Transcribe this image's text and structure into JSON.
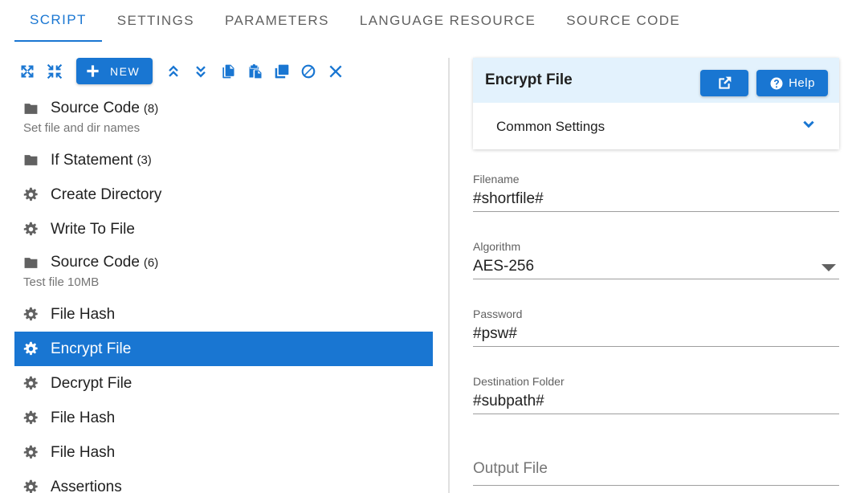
{
  "tabs": [
    {
      "label": "SCRIPT",
      "active": true
    },
    {
      "label": "SETTINGS",
      "active": false
    },
    {
      "label": "PARAMETERS",
      "active": false
    },
    {
      "label": "LANGUAGE RESOURCE",
      "active": false
    },
    {
      "label": "SOURCE CODE",
      "active": false
    }
  ],
  "toolbar": {
    "new_label": "NEW",
    "icons": [
      "expand-all-icon",
      "collapse-all-icon",
      "move-up-icon",
      "move-down-icon",
      "copy-icon",
      "paste-icon",
      "duplicate-icon",
      "disable-icon",
      "delete-icon"
    ]
  },
  "tree": [
    {
      "type": "folder",
      "label": "Source Code",
      "count": "(8)",
      "subtext": "Set file and dir names"
    },
    {
      "type": "folder",
      "label": "If Statement",
      "count": "(3)"
    },
    {
      "type": "action",
      "label": "Create Directory"
    },
    {
      "type": "action",
      "label": "Write To File"
    },
    {
      "type": "folder",
      "label": "Source Code",
      "count": "(6)",
      "subtext": "Test file 10MB"
    },
    {
      "type": "action",
      "label": "File Hash"
    },
    {
      "type": "action",
      "label": "Encrypt File",
      "selected": true
    },
    {
      "type": "action",
      "label": "Decrypt File"
    },
    {
      "type": "action",
      "label": "File Hash"
    },
    {
      "type": "action",
      "label": "File Hash"
    },
    {
      "type": "action",
      "label": "Assertions"
    }
  ],
  "panel": {
    "title": "Encrypt File",
    "help_label": "Help",
    "common_settings_label": "Common Settings",
    "fields": {
      "filename": {
        "label": "Filename",
        "value": "#shortfile#"
      },
      "algorithm": {
        "label": "Algorithm",
        "value": "AES-256"
      },
      "password": {
        "label": "Password",
        "value": "#psw#"
      },
      "destination": {
        "label": "Destination Folder",
        "value": "#subpath#"
      },
      "output": {
        "placeholder": "Output File"
      }
    }
  },
  "colors": {
    "accent": "#1976d2",
    "header_bg": "#e3f2fd"
  }
}
